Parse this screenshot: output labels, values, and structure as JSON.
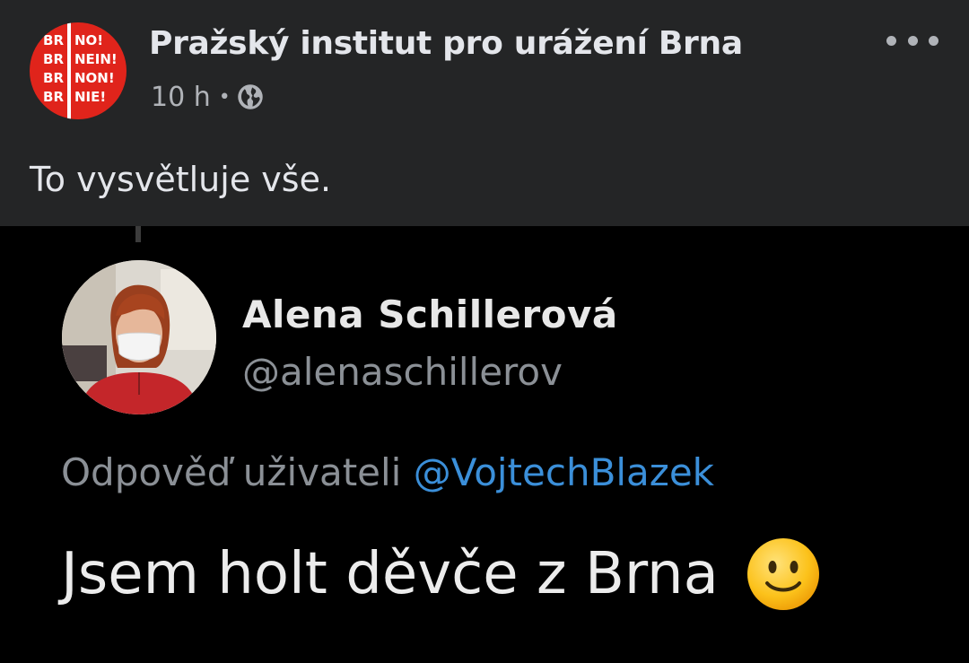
{
  "post": {
    "page_name": "Pražský institut pro urážení Brna",
    "time": "10 h",
    "separator": "•",
    "privacy_icon": "globe-icon",
    "more_icon": "more-horizontal-icon",
    "text": "To vysvětluje vše.",
    "logo": {
      "left": [
        "BR",
        "BR",
        "BR",
        "BR"
      ],
      "right": [
        "NO!",
        "NEIN!",
        "NON!",
        "NIE!"
      ],
      "color": "#e0241b"
    }
  },
  "tweet": {
    "name": "Alena Schillerová",
    "handle": "@alenaschillerov",
    "reply_label": "Odpověď uživateli",
    "reply_mention": "@VojtechBlazek",
    "body": "Jsem holt děvče z Brna",
    "emoji": "slightly-smiling-face-icon",
    "mention_color": "#3b8fd9"
  }
}
